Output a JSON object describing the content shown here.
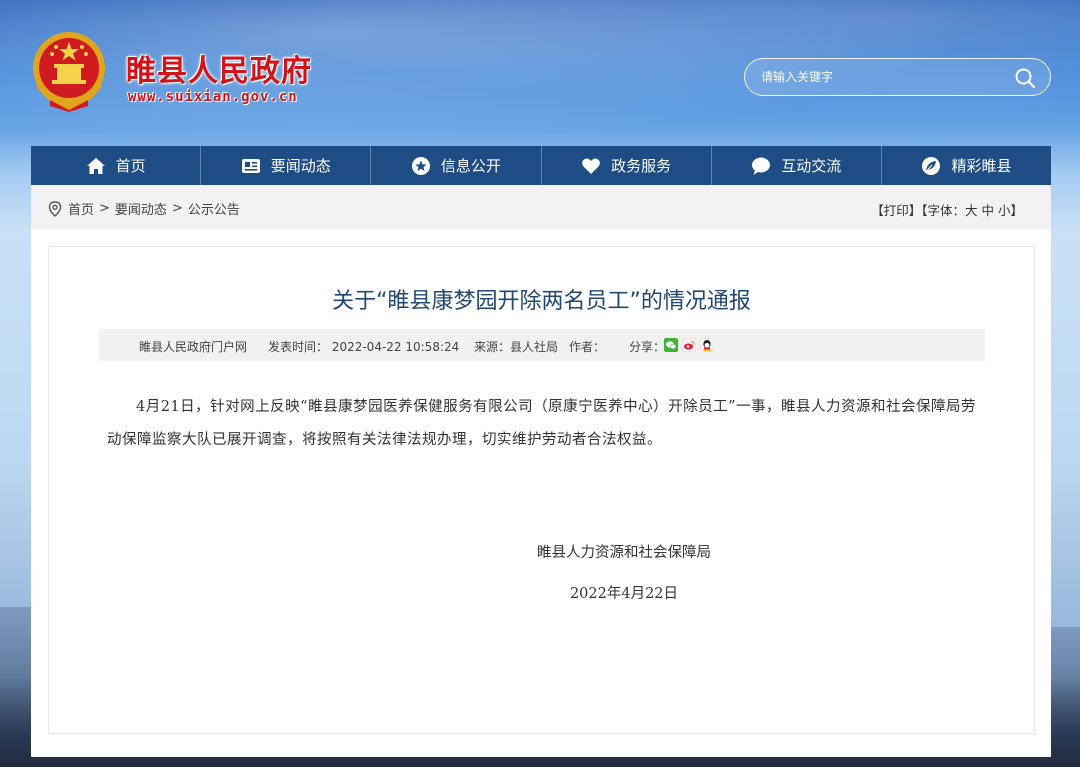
{
  "site": {
    "title": "睢县人民政府",
    "url": "www.suixian.gov.cn"
  },
  "search": {
    "placeholder": "请输入关键字"
  },
  "nav": {
    "items": [
      {
        "label": "首页",
        "icon": "home-icon"
      },
      {
        "label": "要闻动态",
        "icon": "news-icon"
      },
      {
        "label": "信息公开",
        "icon": "star-icon"
      },
      {
        "label": "政务服务",
        "icon": "heart-icon"
      },
      {
        "label": "互动交流",
        "icon": "chat-icon"
      },
      {
        "label": "精彩睢县",
        "icon": "leaf-icon"
      }
    ]
  },
  "breadcrumb": {
    "items": [
      "首页",
      "要闻动态",
      "公示公告"
    ],
    "separator": ">"
  },
  "tools": {
    "print": "【打印】",
    "font_prefix": "【字体：",
    "font_large": "大",
    "font_medium": "中",
    "font_small": "小",
    "font_suffix": "】"
  },
  "article": {
    "title": "关于“睢县康梦园开除两名员工”的情况通报",
    "meta": {
      "site": "睢县人民政府门户网",
      "published": "发表时间： 2022-04-22 10:58:24",
      "source": "来源：县人社局",
      "author": "作者：",
      "share": "分享："
    },
    "body": "4月21日，针对网上反映“睢县康梦园医养保健服务有限公司（原康宁医养中心）开除员工”一事，睢县人力资源和社会保障局劳动保障监察大队已展开调查，将按照有关法律法规办理，切实维护劳动者合法权益。",
    "signature": "睢县人力资源和社会保障局",
    "date": "2022年4月22日"
  },
  "colors": {
    "nav_bg": "#1d4d84",
    "title_red": "#d2141a",
    "article_title": "#22486f"
  }
}
